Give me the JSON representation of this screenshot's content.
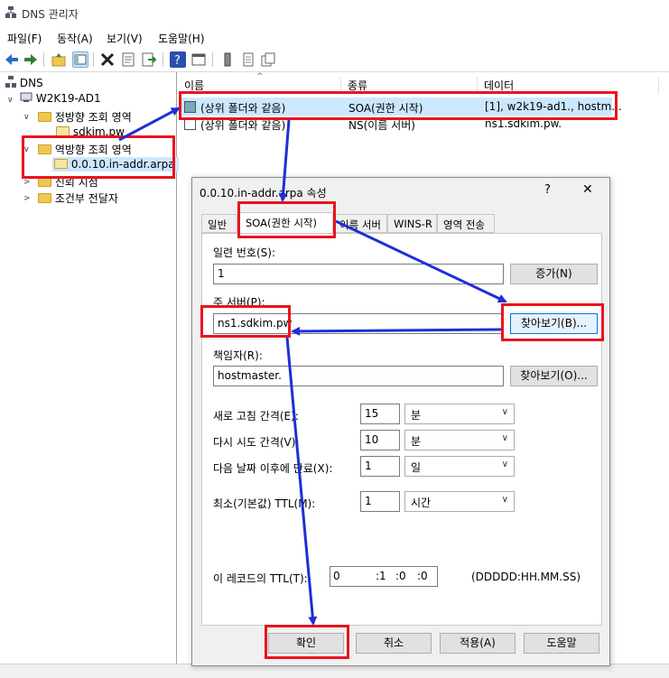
{
  "window": {
    "title": "DNS 관리자"
  },
  "menu": [
    "파일(F)",
    "동작(A)",
    "보기(V)",
    "도움말(H)"
  ],
  "tree": {
    "root": "DNS",
    "server": "W2K19-AD1",
    "forward_zones": "정방향 조회 영역",
    "forward_child": "sdkim.pw",
    "reverse_zones": "역방향 조회 영역",
    "reverse_child": "0.0.10.in-addr.arpa",
    "trust_points": "신뢰 지점",
    "conditional_forwarders": "조건부 전달자"
  },
  "list": {
    "columns": [
      "이름",
      "종류",
      "데이터"
    ],
    "rows": [
      {
        "name": "(상위 폴더와 같음)",
        "type": "SOA(권한 시작)",
        "data": "[1], w2k19-ad1., hostm..."
      },
      {
        "name": "(상위 폴더와 같음)",
        "type": "NS(이름 서버)",
        "data": "ns1.sdkim.pw."
      }
    ]
  },
  "dialog": {
    "title": "0.0.10.in-addr.arpa 속성",
    "help_glyph": "?",
    "close_glyph": "✕",
    "tabs": [
      "일반",
      "SOA(권한 시작)",
      "이름 서버",
      "WINS-R",
      "영역 전송"
    ],
    "serial_label": "일련 번호(S):",
    "serial_value": "1",
    "increment_button": "증가(N)",
    "primary_label": "주 서버(P):",
    "primary_value": "ns1.sdkim.pw",
    "browse_b": "찾아보기(B)...",
    "responsible_label": "책임자(R):",
    "responsible_value": "hostmaster.",
    "browse_o": "찾아보기(O)...",
    "refresh_label": "새로 고침 간격(E):",
    "refresh_value": "15",
    "refresh_unit": "분",
    "retry_label": "다시 시도 간격(V):",
    "retry_value": "10",
    "retry_unit": "분",
    "expire_label": "다음 날짜 이후에 만료(X):",
    "expire_value": "1",
    "expire_unit": "일",
    "minttl_label": "최소(기본값) TTL(M):",
    "minttl_value": "1",
    "minttl_unit": "시간",
    "recttl_label": "이 레코드의 TTL(T):",
    "recttl_d": "0",
    "recttl_h": ":1",
    "recttl_m": ":0",
    "recttl_s": ":0",
    "recttl_format": "(DDDDD:HH.MM.SS)",
    "ok": "확인",
    "cancel": "취소",
    "apply": "적용(A)",
    "help": "도움말"
  },
  "colors": {
    "highlight": "#e8141f",
    "arrow": "#1f2fd6",
    "selected": "#cce8ff"
  }
}
